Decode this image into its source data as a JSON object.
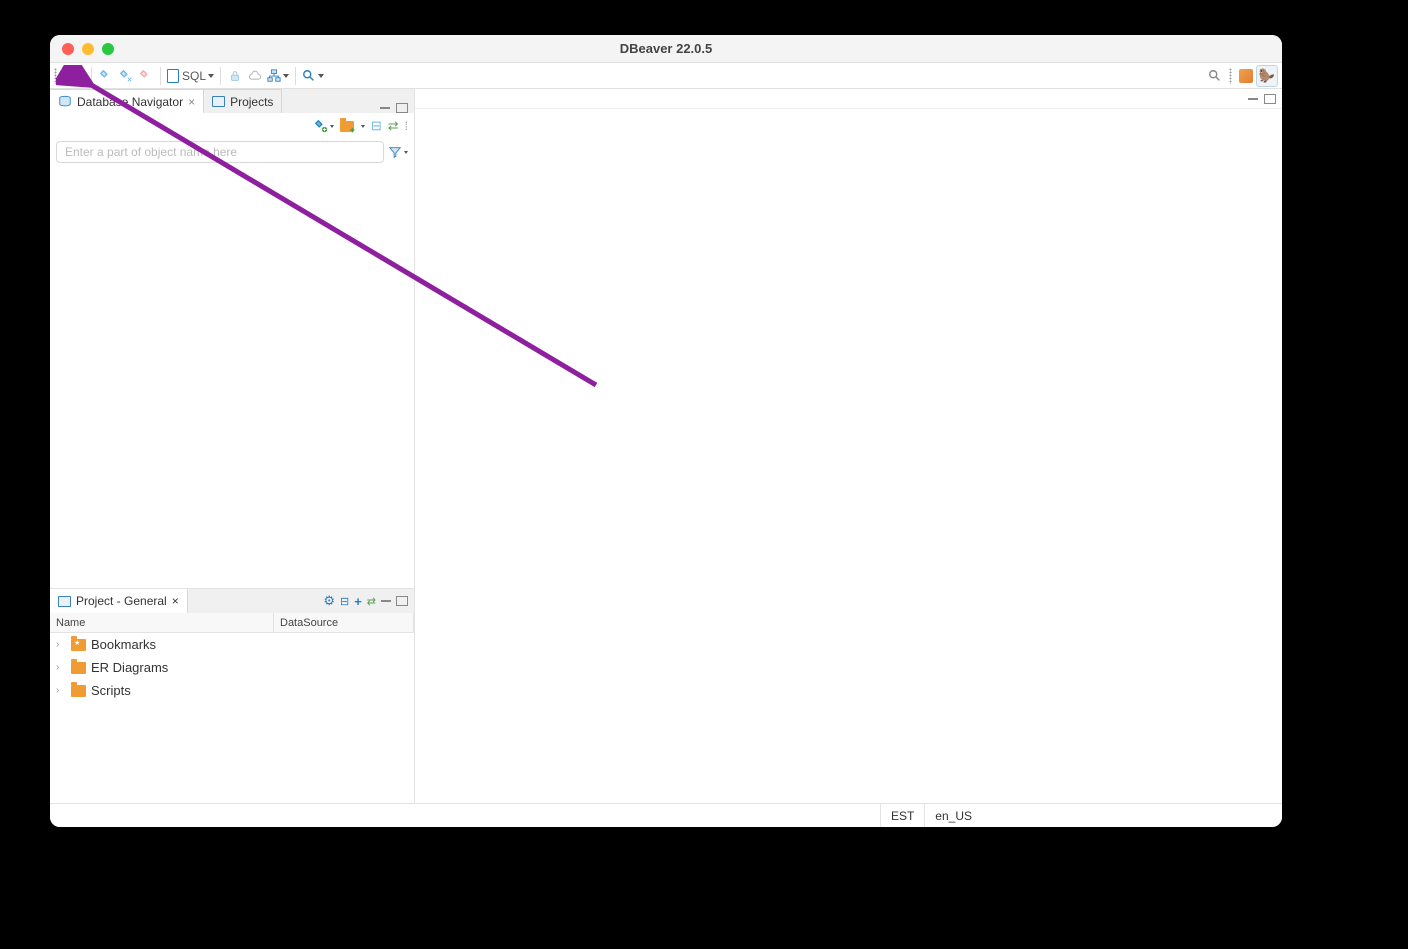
{
  "window": {
    "title": "DBeaver 22.0.5"
  },
  "toolbar": {
    "sql_label": "SQL"
  },
  "tabs": {
    "navigator": "Database Navigator",
    "projects": "Projects"
  },
  "navigator": {
    "filter_placeholder": "Enter a part of object name here"
  },
  "project_panel": {
    "title": "Project - General",
    "columns": {
      "name": "Name",
      "datasource": "DataSource"
    },
    "items": [
      {
        "label": "Bookmarks"
      },
      {
        "label": "ER Diagrams"
      },
      {
        "label": "Scripts"
      }
    ]
  },
  "statusbar": {
    "tz": "EST",
    "locale": "en_US"
  }
}
